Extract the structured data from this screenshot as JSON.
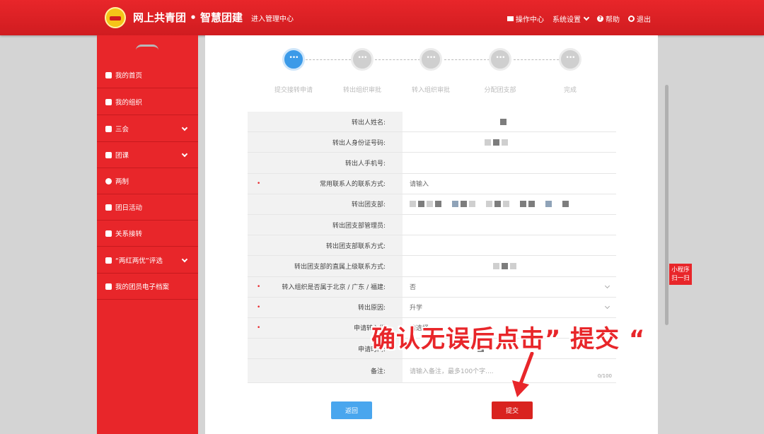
{
  "header": {
    "site_title": "网上共青团 • 智慧团建",
    "admin_link": "进入管理中心",
    "nav": {
      "ops_center": "操作中心",
      "settings": "系统设置",
      "help": "帮助",
      "logout": "退出"
    }
  },
  "sidebar": {
    "items": [
      {
        "label": "我的首页"
      },
      {
        "label": "我的组织"
      },
      {
        "label": "三会"
      },
      {
        "label": "团课"
      },
      {
        "label": "两制"
      },
      {
        "label": "团日活动"
      },
      {
        "label": "关系接转"
      },
      {
        "label": "“两红两优”评选"
      },
      {
        "label": "我的团员电子档案"
      }
    ]
  },
  "steps": [
    {
      "label": "提交接转申请"
    },
    {
      "label": "转出组织审批"
    },
    {
      "label": "转入组织审批"
    },
    {
      "label": "分配团支部"
    },
    {
      "label": "完成"
    }
  ],
  "form": {
    "rows": [
      {
        "label": "转出人姓名:",
        "value": ""
      },
      {
        "label": "转出人身份证号码:",
        "value": ""
      },
      {
        "label": "转出人手机号:",
        "value": ""
      },
      {
        "label": "常用联系人的联系方式:",
        "value": "请输入"
      },
      {
        "label": "转出团支部:",
        "value": ""
      },
      {
        "label": "转出团支部管理员:",
        "value": ""
      },
      {
        "label": "转出团支部联系方式:",
        "value": ""
      },
      {
        "label": "转出团支部的直属上级联系方式:",
        "value": ""
      },
      {
        "label": "转入组织是否属于北京 / 广东 / 福建:",
        "value": "否"
      },
      {
        "label": "转出原因:",
        "value": "升学"
      },
      {
        "label": "申请转入组",
        "value": "请选择"
      },
      {
        "label": "申请时间:",
        "value": ""
      },
      {
        "label": "备注:",
        "placeholder": "请输入备注，最多100个字....",
        "counter": "0/100"
      }
    ]
  },
  "buttons": {
    "back": "返回",
    "submit": "提交"
  },
  "annotation": {
    "text": "确认无误后点击” 提交 “"
  },
  "mini_program": {
    "line1": "小程序",
    "line2": "扫一扫"
  }
}
